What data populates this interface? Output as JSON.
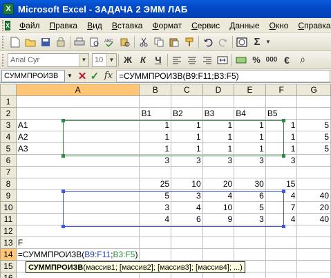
{
  "window": {
    "title": "Microsoft Excel - ЗАДАЧА 2 ЭММ ЛАБ",
    "app_icon_letter": "X"
  },
  "menu": [
    "Файл",
    "Правка",
    "Вид",
    "Вставка",
    "Формат",
    "Сервис",
    "Данные",
    "Окно",
    "Справка"
  ],
  "toolbar_format": {
    "font": "Arial Cyr",
    "size": "10"
  },
  "formula_bar": {
    "name_box": "СУММПРОИЗВ",
    "formula": "=СУММПРОИЗВ(B9:F11;B3:F5)",
    "fx": "fx"
  },
  "columns": [
    "A",
    "B",
    "C",
    "D",
    "E",
    "F",
    "G"
  ],
  "rows": [
    {
      "n": "1",
      "cells": [
        "",
        "",
        "",
        "",
        "",
        "",
        ""
      ]
    },
    {
      "n": "2",
      "cells": [
        "",
        "B1",
        "B2",
        "B3",
        "B4",
        "B5",
        ""
      ]
    },
    {
      "n": "3",
      "cells": [
        "A1",
        "1",
        "1",
        "1",
        "1",
        "1",
        "5"
      ]
    },
    {
      "n": "4",
      "cells": [
        "A2",
        "1",
        "1",
        "1",
        "1",
        "1",
        "5"
      ]
    },
    {
      "n": "5",
      "cells": [
        "A3",
        "1",
        "1",
        "1",
        "1",
        "1",
        "5"
      ]
    },
    {
      "n": "6",
      "cells": [
        "",
        "3",
        "3",
        "3",
        "3",
        "3",
        ""
      ]
    },
    {
      "n": "7",
      "cells": [
        "",
        "",
        "",
        "",
        "",
        "",
        ""
      ]
    },
    {
      "n": "8",
      "cells": [
        "",
        "25",
        "10",
        "20",
        "30",
        "15",
        ""
      ]
    },
    {
      "n": "9",
      "cells": [
        "",
        "5",
        "3",
        "4",
        "6",
        "4",
        "40"
      ]
    },
    {
      "n": "10",
      "cells": [
        "",
        "3",
        "4",
        "10",
        "5",
        "7",
        "20"
      ]
    },
    {
      "n": "11",
      "cells": [
        "",
        "4",
        "6",
        "9",
        "3",
        "4",
        "40"
      ]
    },
    {
      "n": "12",
      "cells": [
        "",
        "",
        "",
        "",
        "",
        "",
        ""
      ]
    },
    {
      "n": "13",
      "cells": [
        "F",
        "",
        "",
        "",
        "",
        "",
        ""
      ]
    },
    {
      "n": "14",
      "cells": [
        "",
        "",
        "",
        "",
        "",
        "",
        ""
      ]
    },
    {
      "n": "15",
      "cells": [
        "",
        "",
        "",
        "",
        "",
        "",
        ""
      ]
    },
    {
      "n": "16",
      "cells": [
        "",
        "",
        "",
        "",
        "",
        "",
        ""
      ]
    }
  ],
  "editing_cell": {
    "prefix": "=СУММПРОИЗВ(",
    "ref1": "B9:F11",
    "sep": ";",
    "ref2": "B3:F5",
    "suffix": ")"
  },
  "tooltip": {
    "func": "СУММПРОИЗВ",
    "args": "(массив1; [массив2]; [массив3]; [массив4]; ...)"
  },
  "colors": {
    "ref_blue": "#1f3fa6",
    "ref_green": "#2e8b3e",
    "title_bar": "#0349c8"
  }
}
